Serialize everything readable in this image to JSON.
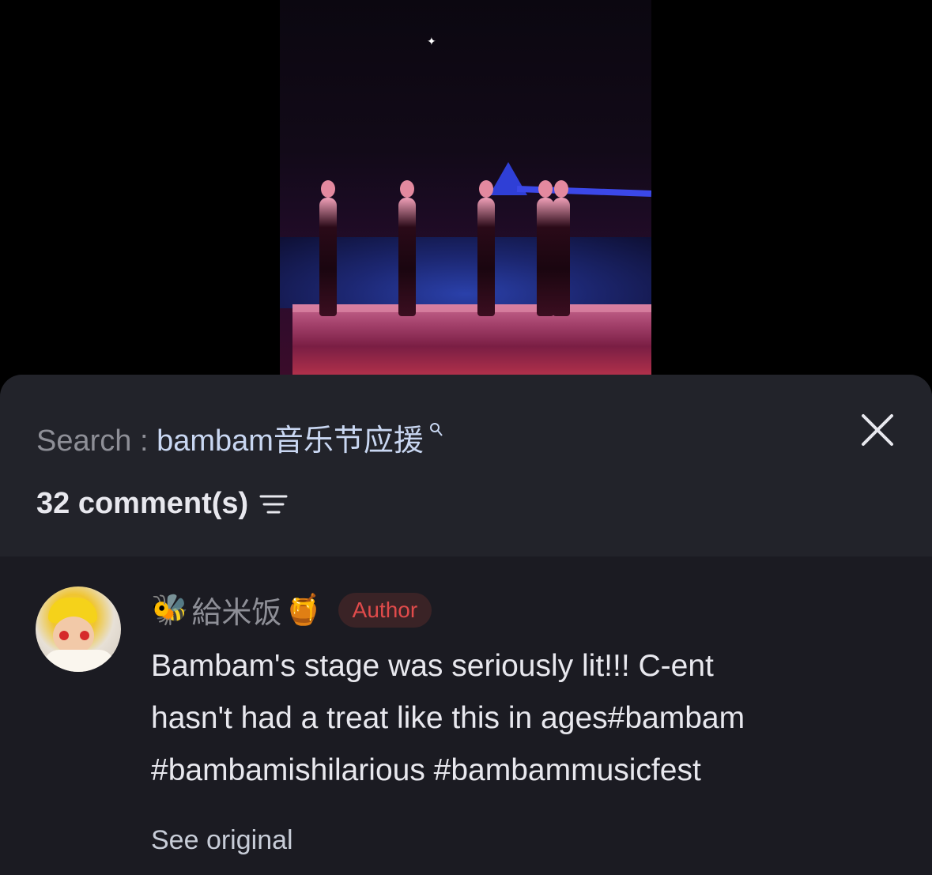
{
  "video": {
    "icon": "play-video-thumbnail"
  },
  "search": {
    "label": "Search : ",
    "query": "bambam音乐节应援",
    "query_icon": "search-icon"
  },
  "comments_header": {
    "count_label": "32 comment(s)",
    "filter_icon": "sort-filter-icon"
  },
  "comment": {
    "username_prefix_emoji": "🐝",
    "username": "給米饭",
    "username_suffix_emoji": "🍯",
    "author_badge": "Author",
    "text_line1": "Bambam's stage was seriously lit!!! C-ent",
    "text_line2": "hasn't had a treat like this in ages#bambam",
    "text_line3": "#bambamishilarious #bambammusicfest",
    "see_original": "See original"
  },
  "colors": {
    "sheet_bg": "#1b1b22",
    "header_bg": "#22232a",
    "query_color": "#c9d7f2",
    "author_red": "#e04b4b"
  }
}
